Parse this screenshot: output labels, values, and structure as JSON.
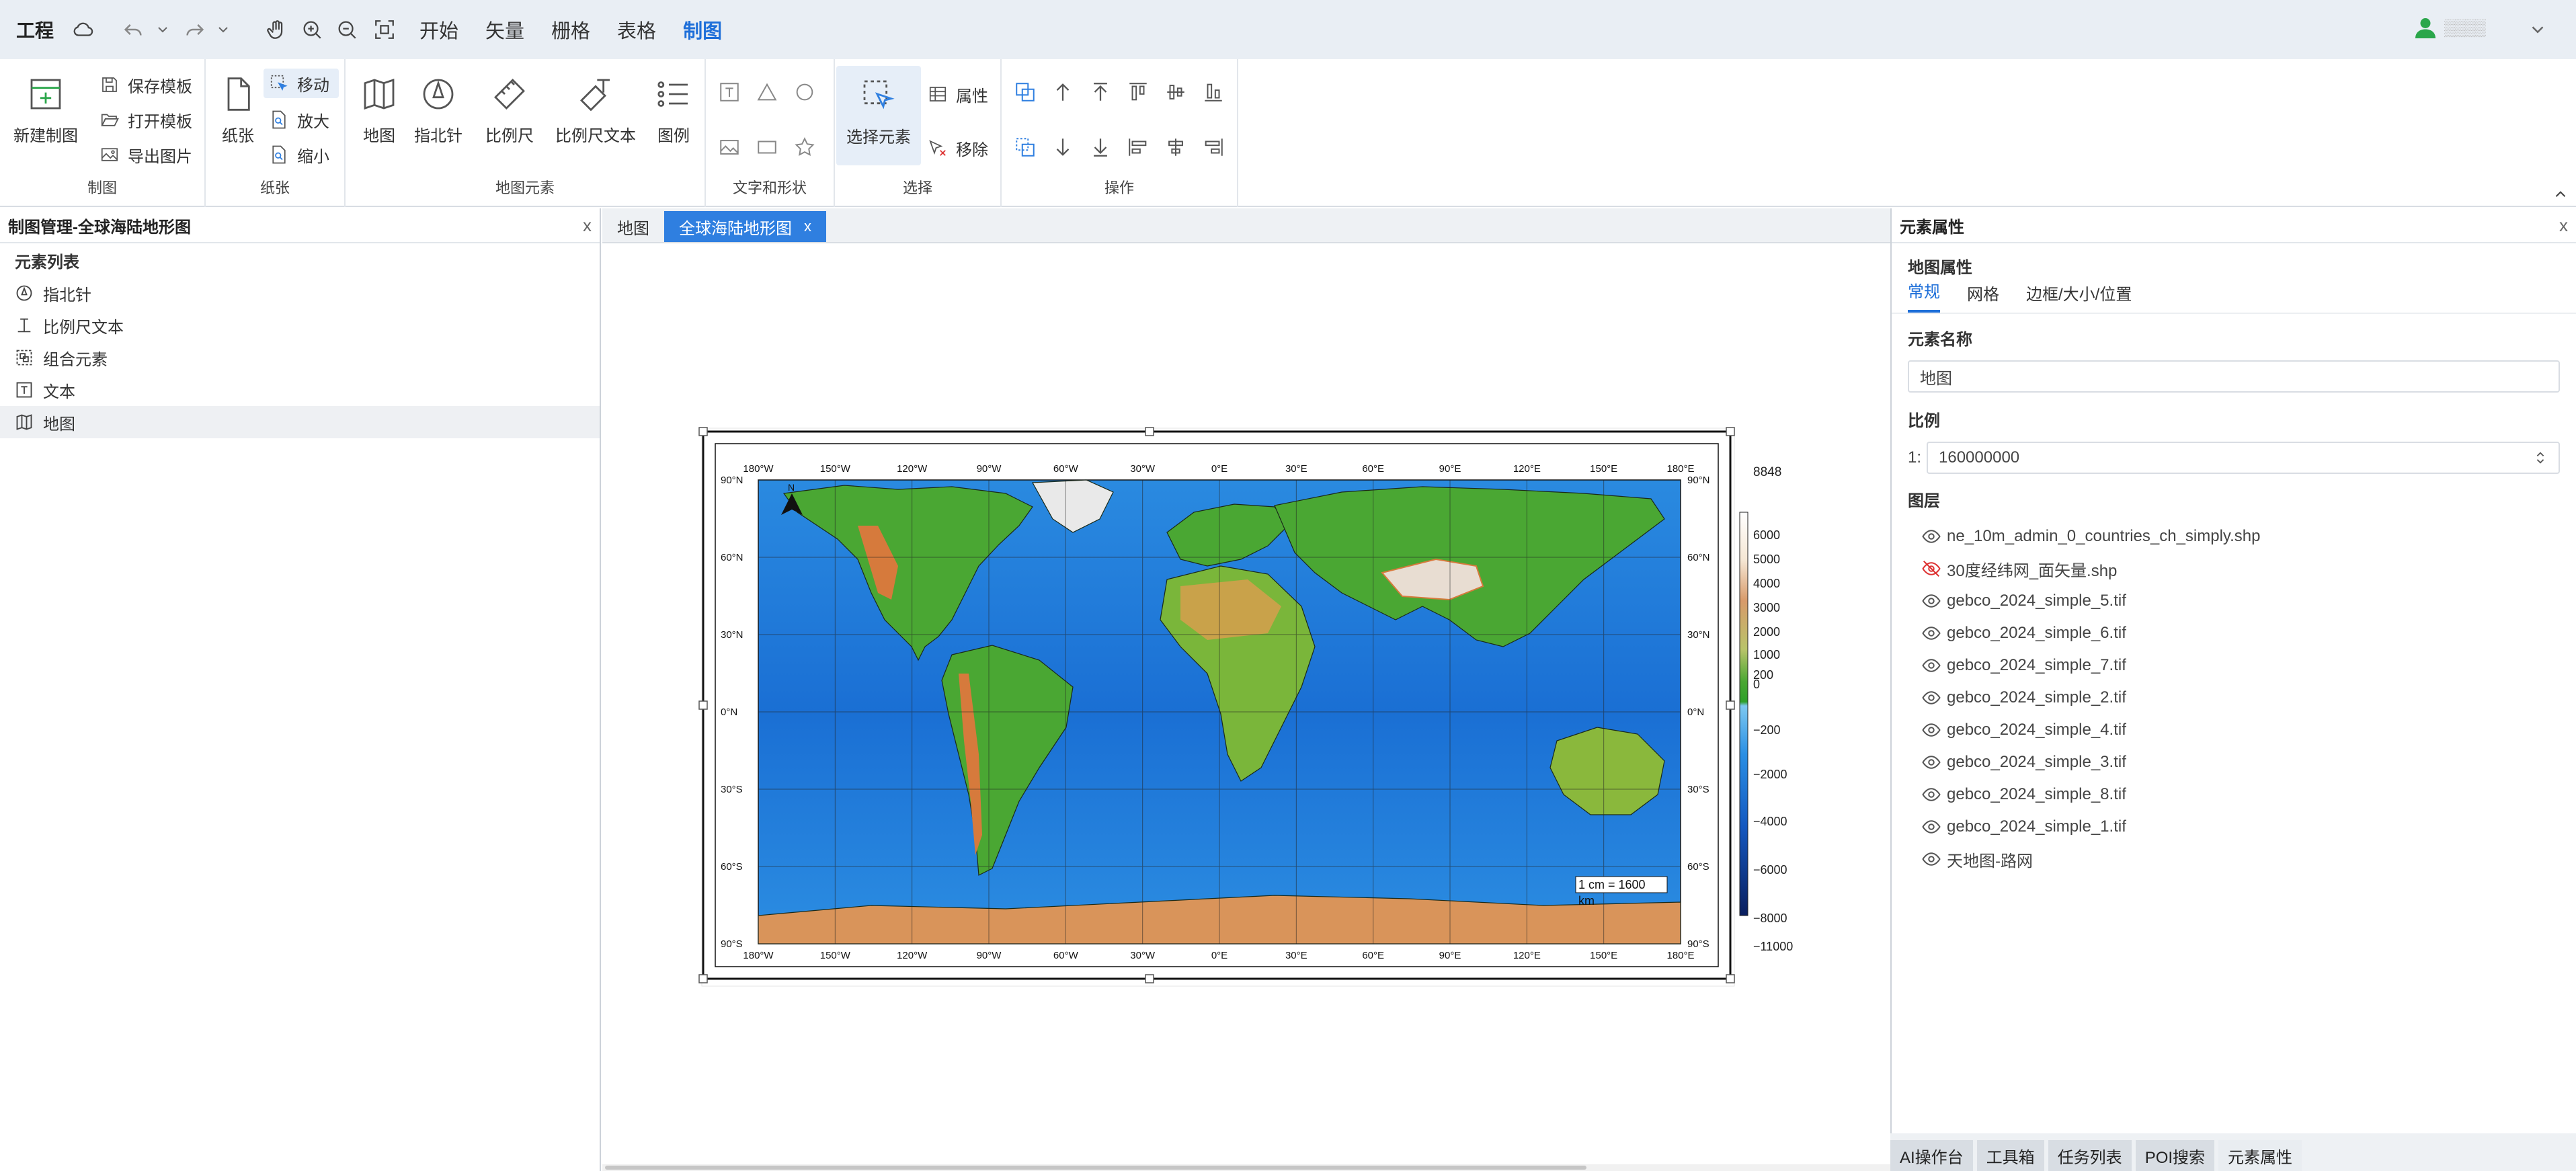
{
  "topbar": {
    "project_label": "工程",
    "menus": [
      "开始",
      "矢量",
      "栅格",
      "表格",
      "制图"
    ],
    "active_menu": "制图",
    "user_name": "▒▒▒▒"
  },
  "ribbon": {
    "group_labels": {
      "mapping": "制图",
      "paper": "纸张",
      "elements": "地图元素",
      "text_shape": "文字和形状",
      "select": "选择",
      "operate": "操作"
    },
    "new_map": "新建制图",
    "save_template": "保存模板",
    "open_template": "打开模板",
    "export_image": "导出图片",
    "paper": "纸张",
    "move": "移动",
    "zoom_in": "放大",
    "zoom_out": "缩小",
    "map": "地图",
    "north_arrow": "指北针",
    "scale_bar": "比例尺",
    "scale_text": "比例尺文本",
    "legend": "图例",
    "select_element": "选择元素",
    "properties": "属性",
    "remove": "移除"
  },
  "left_panel": {
    "title": "制图管理-全球海陆地形图",
    "close": "x",
    "section": "元素列表",
    "elements": [
      "指北针",
      "比例尺文本",
      "组合元素",
      "文本",
      "地图"
    ],
    "selected": "地图"
  },
  "center": {
    "tabs": [
      "地图",
      "全球海陆地形图"
    ],
    "active_tab": "全球海陆地形图",
    "tab_close": "x",
    "map": {
      "lon_labels": [
        "180°W",
        "150°W",
        "120°W",
        "90°W",
        "60°W",
        "30°W",
        "0°E",
        "30°E",
        "60°E",
        "90°E",
        "120°E",
        "150°E",
        "180°E"
      ],
      "lat_labels": [
        "90°N",
        "60°N",
        "30°N",
        "0°N",
        "30°S",
        "60°S",
        "90°S"
      ],
      "north_label": "N",
      "scale_text_line1": "1 cm = 1600",
      "scale_text_line2": "km",
      "legend_max": "8848",
      "legend_ticks": [
        "6000",
        "5000",
        "4000",
        "3000",
        "2000",
        "1000",
        "200",
        "0",
        "−200",
        "−2000",
        "−4000",
        "−6000",
        "−8000",
        "−11000"
      ],
      "colors": {
        "ocean": "#1c78d8",
        "ocean_deep": "#1361c8",
        "ocean_shallow": "#3a9de8",
        "land": "#4aa733",
        "land_high": "#c9a24a",
        "mountain": "#d67a3c",
        "ice": "#f2f2f2",
        "antarctica": "#d9945a"
      }
    }
  },
  "right_panel": {
    "title": "元素属性",
    "close": "x",
    "heading": "地图属性",
    "subtabs": [
      "常规",
      "网格",
      "边框/大小/位置"
    ],
    "active_subtab": "常规",
    "name_label": "元素名称",
    "name_value": "地图",
    "scale_label": "比例",
    "scale_prefix": "1:",
    "scale_value": "160000000",
    "layers_label": "图层",
    "layers": [
      {
        "name": "ne_10m_admin_0_countries_ch_simply.shp",
        "visible": true
      },
      {
        "name": "30度经纬网_面矢量.shp",
        "visible": false
      },
      {
        "name": "gebco_2024_simple_5.tif",
        "visible": true
      },
      {
        "name": "gebco_2024_simple_6.tif",
        "visible": true
      },
      {
        "name": "gebco_2024_simple_7.tif",
        "visible": true
      },
      {
        "name": "gebco_2024_simple_2.tif",
        "visible": true
      },
      {
        "name": "gebco_2024_simple_4.tif",
        "visible": true
      },
      {
        "name": "gebco_2024_simple_3.tif",
        "visible": true
      },
      {
        "name": "gebco_2024_simple_8.tif",
        "visible": true
      },
      {
        "name": "gebco_2024_simple_1.tif",
        "visible": true
      },
      {
        "name": "天地图-路网",
        "visible": true
      }
    ]
  },
  "bottom_tabs": [
    "AI操作台",
    "工具箱",
    "任务列表",
    "POI搜索",
    "元素属性"
  ],
  "active_bottom_tab": "元素属性"
}
